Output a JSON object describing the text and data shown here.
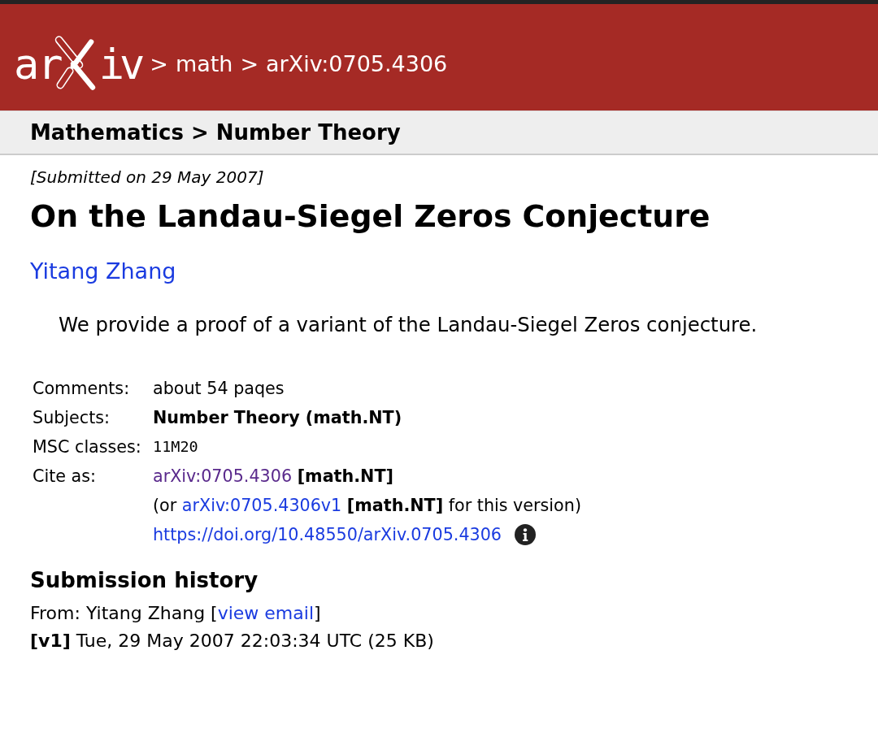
{
  "header": {
    "logo": {
      "left": "ar",
      "right": "iv"
    },
    "breadcrumbs": [
      {
        "separator": ">",
        "label": "math"
      },
      {
        "separator": ">",
        "label": "arXiv:0705.4306"
      }
    ]
  },
  "category": "Mathematics > Number Theory",
  "paper": {
    "submitted": "[Submitted on 29 May 2007]",
    "title": "On the Landau-Siegel Zeros Conjecture",
    "author": "Yitang Zhang",
    "abstract": "We provide a proof of a variant of the Landau-Siegel Zeros conjecture."
  },
  "metadata": [
    {
      "kind": "plain",
      "label": "Comments:",
      "value": "about 54 paqes"
    },
    {
      "kind": "bold",
      "label": "Subjects:",
      "value": "Number Theory (math.NT)"
    },
    {
      "kind": "mono",
      "label": "MSC classes:",
      "value": "11M20"
    },
    {
      "kind": "cite",
      "label": "Cite as:",
      "lines": [
        {
          "link": "arXiv:0705.4306",
          "visited": true,
          "tag": "[math.NT]"
        },
        {
          "before": "(or",
          "link": "arXiv:0705.4306v1",
          "visited": false,
          "tag": "[math.NT]",
          "after": "for this version)"
        },
        {
          "link": "https://doi.org/10.48550/arXiv.0705.4306",
          "visited": false,
          "info_icon": true
        }
      ]
    }
  ],
  "history": {
    "heading": "Submission history",
    "from": {
      "before": "From: Yitang Zhang [",
      "link": "view email",
      "after": "]"
    },
    "versions": [
      "**[v1]** Tue, 29 May 2007 22:03:34 UTC (25 KB)"
    ]
  }
}
